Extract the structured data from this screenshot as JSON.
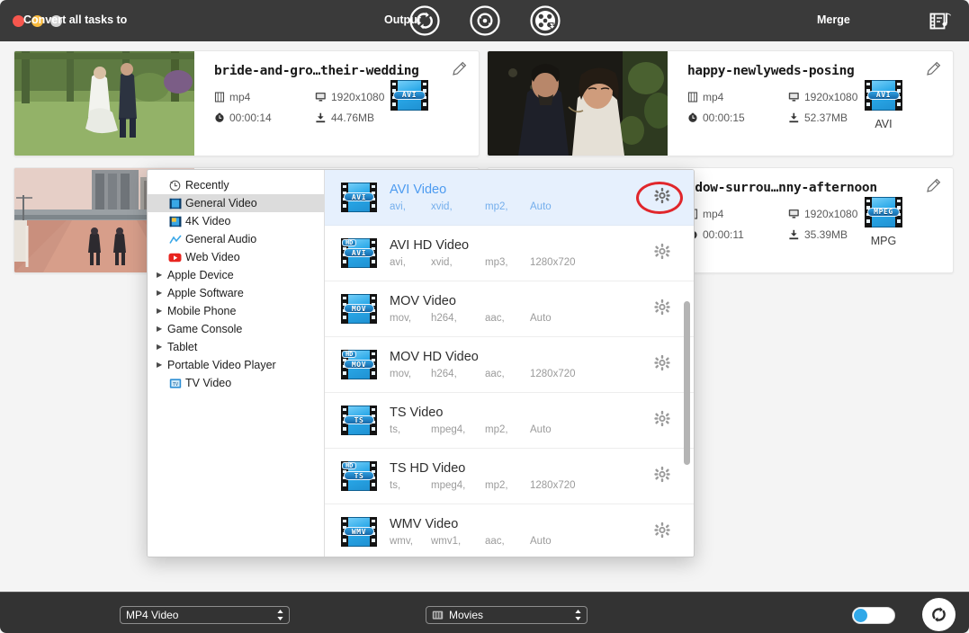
{
  "window": {
    "traffic_lights": [
      "close",
      "minimize",
      "zoom"
    ],
    "toolbar_icons": [
      "converter-icon",
      "ripper-icon",
      "downloader-icon"
    ],
    "toolbar_right_icon": "media-toolbox-icon"
  },
  "cards": [
    {
      "title": "bride-and-gro…their-wedding",
      "format": "mp4",
      "resolution": "1920x1080",
      "duration": "00:00:14",
      "size": "44.76MB",
      "target_badge": "AVI",
      "target_label": "",
      "thumb": "wedding-couple-garden"
    },
    {
      "title": "happy-newlyweds-posing",
      "format": "mp4",
      "resolution": "1920x1080",
      "duration": "00:00:15",
      "size": "52.37MB",
      "target_badge": "AVI",
      "target_label": "AVI",
      "thumb": "newlyweds-portrait"
    },
    {
      "title": "",
      "format": "",
      "resolution": "",
      "duration": "",
      "size": "",
      "target_badge": "",
      "target_label": "",
      "thumb": "runners-on-bridge"
    },
    {
      "title": "adow-surrou…nny-afternoon",
      "format": "mp4",
      "resolution": "1920x1080",
      "duration": "00:00:11",
      "size": "35.39MB",
      "target_badge": "MPEG",
      "target_label": "MPG",
      "thumb": "plain-white"
    }
  ],
  "panel": {
    "categories": [
      {
        "label": "Recently",
        "icon": "clock-icon",
        "expandable": false,
        "selected": false
      },
      {
        "label": "General Video",
        "icon": "video-icon",
        "expandable": false,
        "selected": true
      },
      {
        "label": "4K Video",
        "icon": "4k-video-icon",
        "expandable": false,
        "selected": false
      },
      {
        "label": "General Audio",
        "icon": "audio-wave-icon",
        "expandable": false,
        "selected": false
      },
      {
        "label": "Web Video",
        "icon": "youtube-icon",
        "expandable": false,
        "selected": false
      },
      {
        "label": "Apple Device",
        "icon": "",
        "expandable": true,
        "selected": false
      },
      {
        "label": "Apple Software",
        "icon": "",
        "expandable": true,
        "selected": false
      },
      {
        "label": "Mobile Phone",
        "icon": "",
        "expandable": true,
        "selected": false
      },
      {
        "label": "Game Console",
        "icon": "",
        "expandable": true,
        "selected": false
      },
      {
        "label": "Tablet",
        "icon": "",
        "expandable": true,
        "selected": false
      },
      {
        "label": "Portable Video Player",
        "icon": "",
        "expandable": true,
        "selected": false
      },
      {
        "label": "TV Video",
        "icon": "tv-icon",
        "expandable": false,
        "selected": false
      }
    ],
    "formats": [
      {
        "name": "AVI Video",
        "container": "avi,",
        "codec": "xvid,",
        "audio": "mp2,",
        "res": "Auto",
        "badge": "AVI",
        "hd": false,
        "active": true,
        "highlighted_gear": true
      },
      {
        "name": "AVI HD Video",
        "container": "avi,",
        "codec": "xvid,",
        "audio": "mp3,",
        "res": "1280x720",
        "badge": "AVI",
        "hd": true,
        "active": false,
        "highlighted_gear": false
      },
      {
        "name": "MOV Video",
        "container": "mov,",
        "codec": "h264,",
        "audio": "aac,",
        "res": "Auto",
        "badge": "MOV",
        "hd": false,
        "active": false,
        "highlighted_gear": false
      },
      {
        "name": "MOV HD Video",
        "container": "mov,",
        "codec": "h264,",
        "audio": "aac,",
        "res": "1280x720",
        "badge": "MOV",
        "hd": true,
        "active": false,
        "highlighted_gear": false
      },
      {
        "name": "TS Video",
        "container": "ts,",
        "codec": "mpeg4,",
        "audio": "mp2,",
        "res": "Auto",
        "badge": "TS",
        "hd": false,
        "active": false,
        "highlighted_gear": false
      },
      {
        "name": "TS HD Video",
        "container": "ts,",
        "codec": "mpeg4,",
        "audio": "mp2,",
        "res": "1280x720",
        "badge": "TS",
        "hd": true,
        "active": false,
        "highlighted_gear": false
      },
      {
        "name": "WMV Video",
        "container": "wmv,",
        "codec": "wmv1,",
        "audio": "aac,",
        "res": "Auto",
        "badge": "WMV",
        "hd": false,
        "active": false,
        "highlighted_gear": false
      }
    ]
  },
  "bottom": {
    "convert_all_label": "Convert all tasks to",
    "convert_all_value": "MP4 Video",
    "output_label": "Output",
    "output_value": "Movies",
    "merge_label": "Merge",
    "convert_button_icon": "convert-icon"
  },
  "colors": {
    "accent": "#31a8e8",
    "active_row": "#e6f0fd",
    "active_text": "#4d9bf0",
    "highlight_ring": "#e0262b",
    "chrome": "#333333"
  }
}
